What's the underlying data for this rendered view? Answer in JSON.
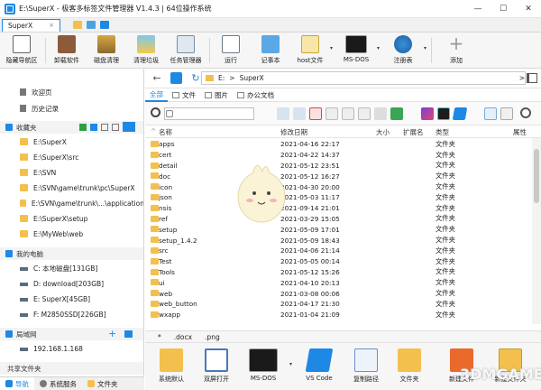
{
  "window": {
    "title": "E:\\SuperX - 极客多标签文件管理器 V1.4.3 | 64位操作系统",
    "controls": [
      "—",
      "☐",
      "✕"
    ]
  },
  "tabs": [
    {
      "label": "SuperX",
      "close": "×"
    }
  ],
  "ribbon": {
    "buttons": [
      {
        "label": "隐藏导航区"
      },
      {
        "label": "卸载软件"
      },
      {
        "label": "磁盘清理"
      },
      {
        "label": "清理垃圾"
      },
      {
        "label": "任务管理器"
      },
      {
        "label": "运行"
      },
      {
        "label": "记事本"
      },
      {
        "label": "host文件"
      },
      {
        "label": "MS-DOS"
      },
      {
        "label": "注册表"
      },
      {
        "label": "添加"
      }
    ],
    "dropdown_glyph": "▾"
  },
  "sidebar": {
    "quick": [
      {
        "label": "欢迎页"
      },
      {
        "label": "历史记录"
      }
    ],
    "favorites_header": "收藏夹",
    "favorites": [
      "E:\\SuperX",
      "E:\\SuperX\\src",
      "E:\\SVN",
      "E:\\SVN\\game\\trunk\\pc\\SuperX",
      "E:\\SVN\\game\\trunk\\...\\application",
      "E:\\SuperX\\setup",
      "E:\\MyWeb\\web"
    ],
    "computer_header": "我的电脑",
    "drives": [
      "C: 本地磁盘[131GB]",
      "D: download[203GB]",
      "E: SuperX[45GB]",
      "F: M2850SSD[226GB]"
    ],
    "lan_header": "局域网",
    "lan": [
      "192.168.1.168"
    ],
    "shared_header": "共享文件夹",
    "bottom_nav": [
      "导航",
      "系统服务",
      "文件夹"
    ]
  },
  "address": {
    "back": "←",
    "drive": "E:",
    "folder": "SuperX",
    "sep": ">"
  },
  "filter_tabs": [
    "全部",
    "文件",
    "图片",
    "办公文档"
  ],
  "columns": {
    "name": "名称",
    "modified": "修改日期",
    "size": "大小",
    "ext": "扩展名",
    "type": "类型",
    "attr": "属性"
  },
  "files": [
    {
      "name": "apps",
      "date": "2021-04-16 22:17",
      "type": "文件夹"
    },
    {
      "name": "cert",
      "date": "2021-04-22 14:37",
      "type": "文件夹"
    },
    {
      "name": "detail",
      "date": "2021-05-12 23:51",
      "type": "文件夹"
    },
    {
      "name": "doc",
      "date": "2021-05-12 16:27",
      "type": "文件夹"
    },
    {
      "name": "icon",
      "date": "2021-04-30 20:00",
      "type": "文件夹"
    },
    {
      "name": "json",
      "date": "2021-05-03 11:17",
      "type": "文件夹"
    },
    {
      "name": "nsis",
      "date": "2021-09-14 21:01",
      "type": "文件夹"
    },
    {
      "name": "ref",
      "date": "2021-03-29 15:05",
      "type": "文件夹"
    },
    {
      "name": "setup",
      "date": "2021-05-09 17:01",
      "type": "文件夹"
    },
    {
      "name": "setup_1.4.2",
      "date": "2021-05-09 18:43",
      "type": "文件夹"
    },
    {
      "name": "src",
      "date": "2021-04-06 21:14",
      "type": "文件夹"
    },
    {
      "name": "Test",
      "date": "2021-05-05 00:14",
      "type": "文件夹"
    },
    {
      "name": "Tools",
      "date": "2021-05-12 15:26",
      "type": "文件夹"
    },
    {
      "name": "ui",
      "date": "2021-04-10 20:13",
      "type": "文件夹"
    },
    {
      "name": "web",
      "date": "2021-03-08 00:06",
      "type": "文件夹"
    },
    {
      "name": "web_button",
      "date": "2021-04-17 21:30",
      "type": "文件夹"
    },
    {
      "name": "wxapp",
      "date": "2021-01-04 21:09",
      "type": "文件夹"
    }
  ],
  "ext_bar": [
    "*",
    ".docx",
    ".png"
  ],
  "bottom_tools": [
    {
      "label": "系统默认"
    },
    {
      "label": "双屏打开"
    },
    {
      "label": "MS-DOS"
    },
    {
      "label": "VS Code"
    },
    {
      "label": "复制路径"
    },
    {
      "label": "文件夹"
    },
    {
      "label": "新建文件"
    },
    {
      "label": "新建文件夹"
    }
  ],
  "watermark": "3DMGAME",
  "colors": {
    "accent": "#1e88e5",
    "folder": "#f3c04e"
  }
}
